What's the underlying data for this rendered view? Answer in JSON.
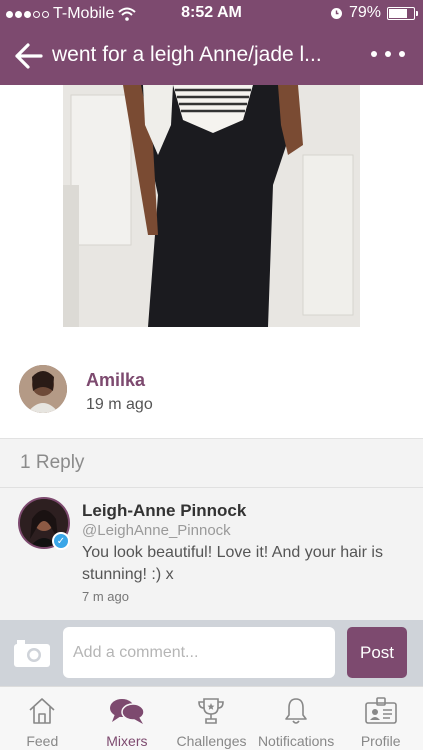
{
  "status_bar": {
    "carrier": "T-Mobile",
    "time": "8:52 AM",
    "battery_percent": "79%",
    "battery_level": 0.79
  },
  "nav": {
    "title": "went for a leigh Anne/jade l...",
    "back_icon": "arrow-left-icon",
    "more_icon": "more-icon"
  },
  "post": {
    "author_name": "Amilka",
    "time_ago": "19 m ago"
  },
  "replies": {
    "count_label": "1 Reply",
    "items": [
      {
        "name": "Leigh-Anne Pinnock",
        "handle": "@LeighAnne_Pinnock",
        "text": "You look beautiful! Love it! And your hair is stunning! :) x",
        "time_ago": "7 m ago",
        "verified": true
      }
    ]
  },
  "composer": {
    "placeholder": "Add a comment...",
    "post_label": "Post"
  },
  "tabs": [
    {
      "label": "Feed",
      "icon": "home-icon",
      "active": false
    },
    {
      "label": "Mixers",
      "icon": "chat-bubbles-icon",
      "active": true
    },
    {
      "label": "Challenges",
      "icon": "trophy-icon",
      "active": false
    },
    {
      "label": "Notifications",
      "icon": "bell-icon",
      "active": false
    },
    {
      "label": "Profile",
      "icon": "profile-card-icon",
      "active": false
    }
  ],
  "colors": {
    "accent": "#7d4a6f",
    "composer_bg": "#cfd3d9",
    "reply_bg": "#f3f3f3"
  }
}
